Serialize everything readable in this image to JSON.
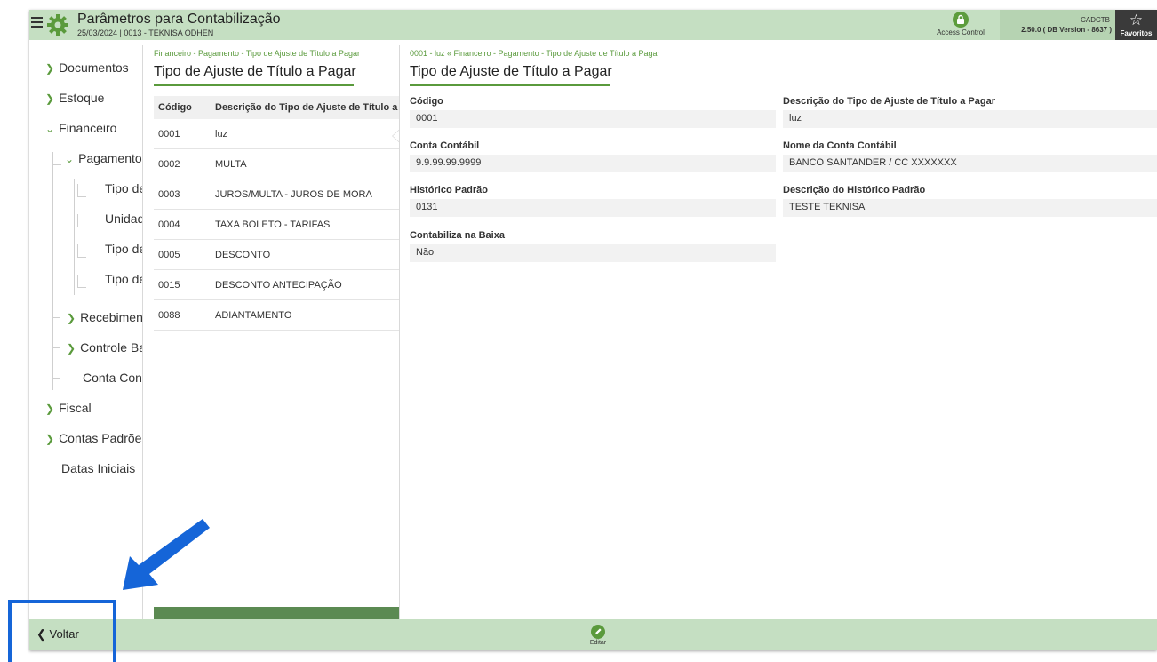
{
  "header": {
    "title": "Parâmetros para Contabilização",
    "subtitle": "25/03/2024 | 0013 - TEKNISA ODHEN",
    "access_control_label": "Access Control",
    "module_code": "CADCTB",
    "version": "2.50.0 ( DB Version - 8637 )",
    "favorites_label": "Favoritos"
  },
  "sidebar": {
    "items": [
      {
        "label": "Documentos"
      },
      {
        "label": "Estoque"
      },
      {
        "label": "Financeiro"
      },
      {
        "label": "Pagamento"
      },
      {
        "label": "Tipo de Ajuste de Título a Pagar"
      },
      {
        "label": "Unidade"
      },
      {
        "label": "Tipo de"
      },
      {
        "label": "Tipo de"
      },
      {
        "label": "Recebimento"
      },
      {
        "label": "Controle Bancário"
      },
      {
        "label": "Conta Contábil"
      },
      {
        "label": "Fiscal"
      },
      {
        "label": "Contas Padrões"
      },
      {
        "label": "Datas Iniciais"
      }
    ]
  },
  "list": {
    "breadcrumb": "Financeiro - Pagamento - Tipo de Ajuste de Título a Pagar",
    "title": "Tipo de Ajuste de Título a Pagar",
    "columns": [
      "Código",
      "Descrição do Tipo de Ajuste de Título a Pagar"
    ],
    "rows": [
      {
        "code": "0001",
        "desc": "luz"
      },
      {
        "code": "0002",
        "desc": "MULTA"
      },
      {
        "code": "0003",
        "desc": "JUROS/MULTA - JUROS DE MORA"
      },
      {
        "code": "0004",
        "desc": "TAXA BOLETO - TARIFAS"
      },
      {
        "code": "0005",
        "desc": "DESCONTO"
      },
      {
        "code": "0015",
        "desc": "DESCONTO ANTECIPAÇÃO"
      },
      {
        "code": "0088",
        "desc": "ADIANTAMENTO"
      }
    ]
  },
  "detail": {
    "breadcrumb": "0001 - luz « Financeiro - Pagamento - Tipo de Ajuste de Título a Pagar",
    "title": "Tipo de Ajuste de Título a Pagar",
    "fields": {
      "codigo": {
        "label": "Código",
        "value": "0001"
      },
      "descricao": {
        "label": "Descrição do Tipo de Ajuste de Título a Pagar",
        "value": "luz"
      },
      "conta_contabil": {
        "label": "Conta Contábil",
        "value": "9.9.99.99.9999"
      },
      "nome_conta": {
        "label": "Nome da Conta Contábil",
        "value": "BANCO SANTANDER / CC XXXXXXX"
      },
      "historico": {
        "label": "Histórico Padrão",
        "value": "0131"
      },
      "desc_historico": {
        "label": "Descrição do Histórico Padrão",
        "value": "TESTE TEKNISA"
      },
      "contabiliza_baixa": {
        "label": "Contabiliza na Baixa",
        "value": "Não"
      }
    }
  },
  "footer": {
    "back_label": "Voltar",
    "edit_label": "Editar"
  },
  "colors": {
    "header_bg": "#c5dfc2",
    "accent_green": "#5a9a3c",
    "annotation_blue": "#1565d8",
    "favorites_bg": "#3a3a3a"
  }
}
